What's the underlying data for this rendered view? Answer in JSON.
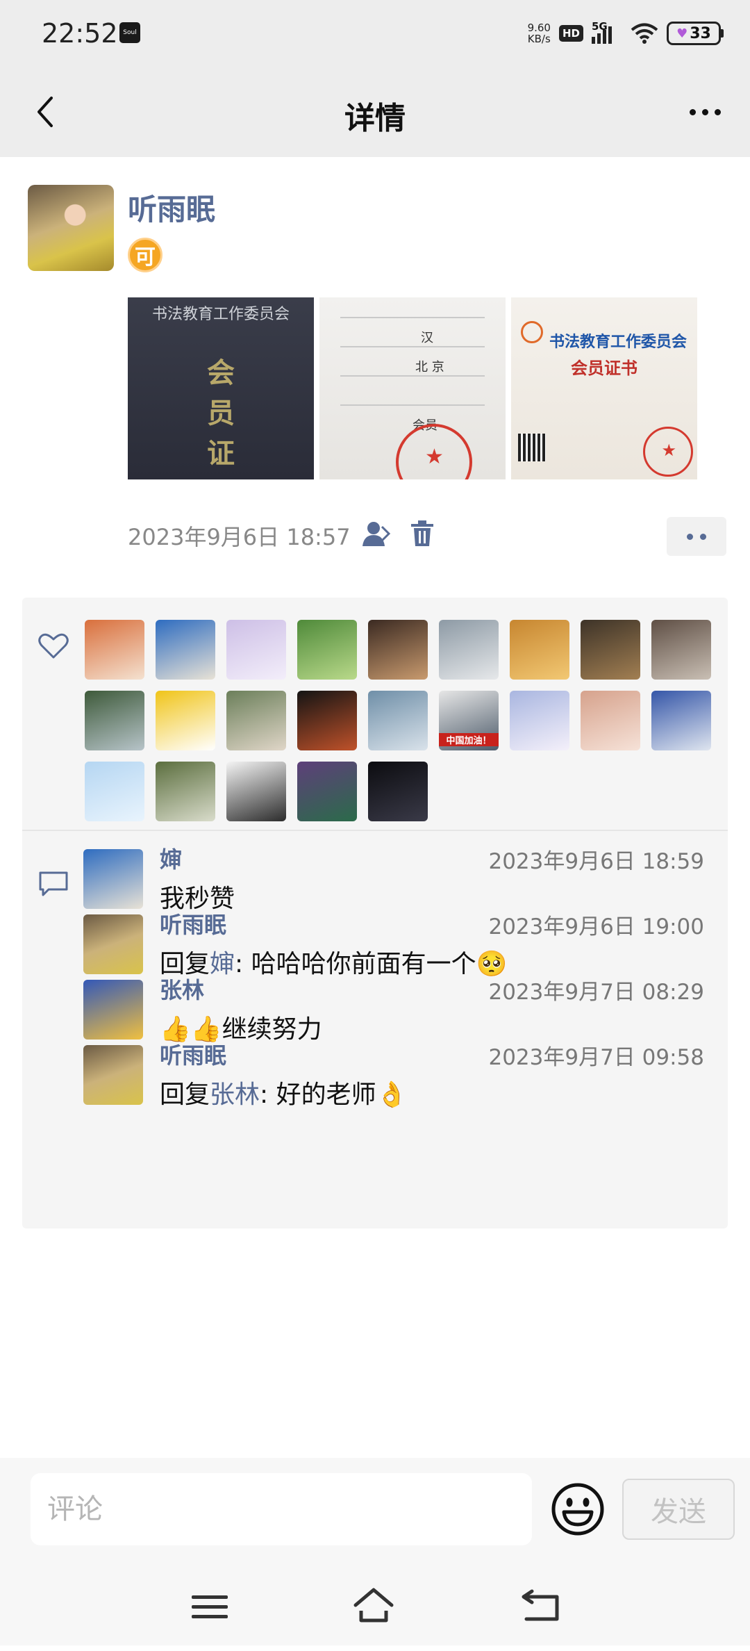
{
  "status_bar": {
    "time": "22:52",
    "app_icon_text": "Soul",
    "net_speed_value": "9.60",
    "net_speed_unit": "KB/s",
    "hd": "HD",
    "network": "5G",
    "battery": "33"
  },
  "header": {
    "title": "详情"
  },
  "post": {
    "author": "听雨眠",
    "badge": "可",
    "time": "2023年9月6日 18:57",
    "photos": [
      {
        "title": "书法教育工作委员会",
        "big_chars": "会\n员\n证"
      },
      {
        "field_1": "汉",
        "field_2": "北 京",
        "field_3": "会员"
      },
      {
        "title": "书法教育工作委员会",
        "subtitle": "会员证书"
      }
    ]
  },
  "likes": {
    "avatars": [
      {
        "name": "avatar-1",
        "colors": [
          "#d96f3c",
          "#f4e1d0"
        ]
      },
      {
        "name": "avatar-2",
        "colors": [
          "#2e6cc0",
          "#e8e2d6"
        ]
      },
      {
        "name": "avatar-3",
        "colors": [
          "#cdbfe6",
          "#f3eefa"
        ]
      },
      {
        "name": "avatar-4",
        "colors": [
          "#4f8a3a",
          "#b9d98a"
        ]
      },
      {
        "name": "avatar-5",
        "colors": [
          "#3b2a22",
          "#c89a6e"
        ]
      },
      {
        "name": "avatar-6",
        "colors": [
          "#8d9aa5",
          "#e6e8ea"
        ]
      },
      {
        "name": "avatar-7",
        "colors": [
          "#c78630",
          "#f2c873"
        ]
      },
      {
        "name": "avatar-8",
        "colors": [
          "#3d3328",
          "#a27f52"
        ]
      },
      {
        "name": "avatar-9",
        "colors": [
          "#5f4f45",
          "#c9bfb4"
        ]
      },
      {
        "name": "avatar-10",
        "colors": [
          "#3e5a3a",
          "#b7c4c9"
        ]
      },
      {
        "name": "avatar-11",
        "colors": [
          "#f0c419",
          "#ffffff"
        ]
      },
      {
        "name": "avatar-12",
        "colors": [
          "#6b7f5a",
          "#e0d6c8"
        ]
      },
      {
        "name": "avatar-13",
        "colors": [
          "#141414",
          "#c0522a"
        ]
      },
      {
        "name": "avatar-14",
        "colors": [
          "#6f8fa8",
          "#d9e2ea"
        ]
      },
      {
        "name": "avatar-15",
        "colors": [
          "#e6e6e6",
          "#4d5b6a"
        ],
        "label": "中国加油！"
      },
      {
        "name": "avatar-16",
        "colors": [
          "#a9b6e0",
          "#f4f0fa"
        ]
      },
      {
        "name": "avatar-17",
        "colors": [
          "#d6a28c",
          "#f6e2d8"
        ]
      },
      {
        "name": "avatar-18",
        "colors": [
          "#3556a8",
          "#dfe5ef"
        ]
      },
      {
        "name": "avatar-19",
        "colors": [
          "#b5d6f2",
          "#e9f4fd"
        ]
      },
      {
        "name": "avatar-20",
        "colors": [
          "#5b6e3e",
          "#d9dccb"
        ]
      },
      {
        "name": "avatar-21",
        "colors": [
          "#f4f4f4",
          "#2c2c2c"
        ]
      },
      {
        "name": "avatar-22",
        "colors": [
          "#5e3f7a",
          "#2b6b4a"
        ]
      },
      {
        "name": "avatar-23",
        "colors": [
          "#0c0c10",
          "#3a3a48"
        ]
      }
    ]
  },
  "comments": [
    {
      "author": "婶",
      "time": "2023年9月6日 18:59",
      "text": "我秒赞",
      "avatar_colors": [
        "#2e6cc0",
        "#e8e2d6"
      ]
    },
    {
      "author": "听雨眠",
      "time": "2023年9月6日 19:00",
      "reply_prefix": "回复",
      "reply_to": "婶",
      "text": ": 哈哈哈你前面有一个",
      "emoji": "🥺",
      "avatar_colors": [
        "#cbb27a",
        "#d9c34a"
      ]
    },
    {
      "author": "张林",
      "time": "2023年9月7日 08:29",
      "text": "继续努力",
      "emoji": "👍👍",
      "avatar_colors": [
        "#3358b8",
        "#f0c040"
      ]
    },
    {
      "author": "听雨眠",
      "time": "2023年9月7日 09:58",
      "reply_prefix": "回复",
      "reply_to": "张林",
      "text": ": 好的老师",
      "emoji": "👌",
      "avatar_colors": [
        "#cbb27a",
        "#d9c34a"
      ]
    }
  ],
  "input": {
    "placeholder": "评论",
    "send_label": "发送"
  },
  "colors": {
    "link": "#576b95",
    "header_bg": "#ededed",
    "panel_bg": "#f5f5f5"
  }
}
